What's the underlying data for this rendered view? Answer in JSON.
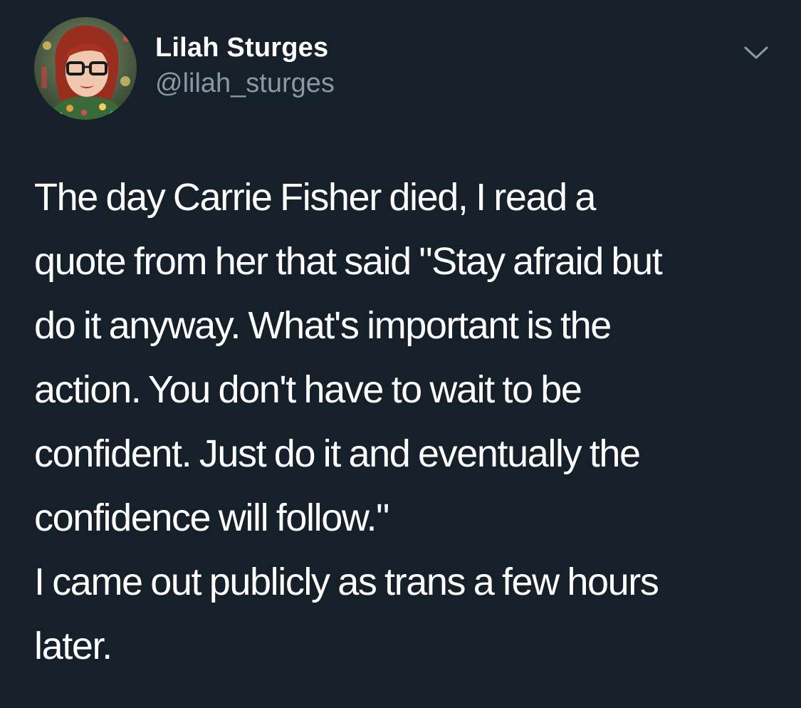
{
  "author": {
    "display_name": "Lilah Sturges",
    "handle": "@lilah_sturges"
  },
  "icons": {
    "menu": "chevron-down-icon"
  },
  "tweet": {
    "lines_p1": [
      "The day Carrie Fisher died, I read a",
      "quote from her that said \"Stay afraid but",
      "do it anyway. What's important is the",
      "action. You don't have to wait to be",
      "confident. Just do it and eventually the",
      "confidence will follow.\""
    ],
    "lines_p2": [
      "I came out publicly as trans a few hours",
      "later."
    ]
  },
  "colors": {
    "background": "#15202b",
    "text": "#ffffff",
    "secondary_text": "#8899a6"
  }
}
